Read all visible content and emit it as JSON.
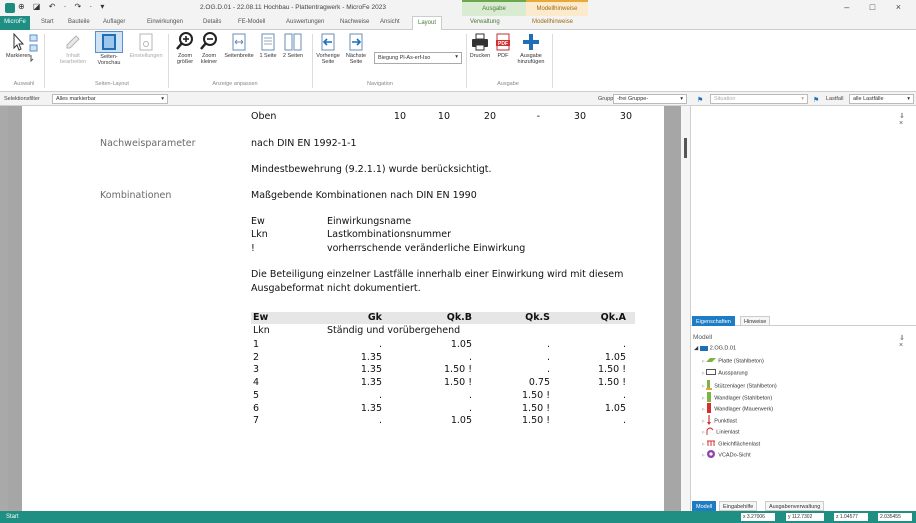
{
  "titlebar": {
    "quick_access": "⊕ ◪ ↶ · ↷ · ▾",
    "title": "2.OG.D.01 - 22.08.11 Hochbau - Plattentragwerk - MicroFe 2023",
    "context_tab_ausgabe": "Ausgabe",
    "context_tab_modellhinweise": "Modellhinweise",
    "window_buttons": "–  □  ×"
  },
  "tabs": {
    "file": "MicroFe",
    "items": [
      "Start",
      "Bauteile",
      "Auflager",
      "Einwirkungen",
      "Details",
      "FE-Modell",
      "Auswertungen",
      "Nachweise",
      "Ansicht",
      "Layout",
      "Verwaltung",
      "Modellhinweise"
    ],
    "collapse": "^ ?"
  },
  "ribbon": {
    "markieren": "Markieren",
    "auswahl_group": "Auswahl",
    "inhalt_bearbeiten": [
      "Inhalt",
      "bearbeiten"
    ],
    "seiten_vorschau": [
      "Seiten-",
      "Vorschau"
    ],
    "einstellungen": "Einstellungen",
    "seiten_layout_group": "Seiten-Layout",
    "zoom_groesser": [
      "Zoom",
      "größer"
    ],
    "zoom_kleiner": [
      "Zoom",
      "kleiner"
    ],
    "seitenbreite": "Seitenbreite",
    "eine_seite": "1 Seite",
    "zwei_seiten": "2 Seiten",
    "anzeige_group": "Anzeige anpassen",
    "vorherige_seite": [
      "Vorherige",
      "Seite"
    ],
    "naechste_seite": [
      "Nächste",
      "Seite"
    ],
    "combo_value": "Biegung Pl-As-erf-Iso",
    "navigation_group": "Navigation",
    "drucken": "Drucken",
    "pdf": "PDF",
    "ausgabe_hinzufuegen": [
      "Ausgabe",
      "hinzufügen"
    ],
    "ausgabe_group": "Ausgabe"
  },
  "filterbar": {
    "selektionsfilter_label": "Selektionsfilter",
    "selektionsfilter_value": "Alles markierbar",
    "gruppe_label": "Gruppe",
    "gruppe_value": "-frei Gruppe-",
    "situation_placeholder": "Situation",
    "lastfall_label": "Lastfall",
    "lastfall_value": "alle Lastfälle"
  },
  "document": {
    "top_row": {
      "label": "Oben",
      "v1": "10",
      "v2": "10",
      "v3": "20",
      "v4": "-",
      "v5": "30",
      "v6": "30"
    },
    "nachweis_heading": "Nachweisparameter",
    "nachweis_norm": "nach DIN EN 1992-1-1",
    "mindestbewehrung": "Mindestbewehrung (9.2.1.1) wurde berücksichtigt.",
    "kombinationen_heading": "Kombinationen",
    "kombinationen_text": "Maßgebende Kombinationen nach DIN EN 1990",
    "legend": [
      {
        "key": "Ew",
        "desc": "Einwirkungsname"
      },
      {
        "key": "Lkn",
        "desc": "Lastkombinationsnummer"
      },
      {
        "key": "!",
        "desc": "vorherrschende veränderliche Einwirkung"
      }
    ],
    "note_line1": "Die Beteiligung einzelner Lastfälle innerhalb einer Einwirkung wird mit diesem",
    "note_line2": "Ausgabeformat nicht dokumentiert.",
    "table": {
      "headers": [
        "Ew",
        "Gk",
        "Qk.B",
        "Qk.S",
        "Qk.A"
      ],
      "sub_lkn": "Lkn",
      "sub_desc": "Ständig und vorübergehend",
      "rows": [
        [
          "1",
          ".",
          "1.05",
          ".",
          "."
        ],
        [
          "2",
          "1.35",
          ".",
          ".",
          "1.05"
        ],
        [
          "3",
          "1.35",
          "1.50 !",
          ".",
          "1.50 !"
        ],
        [
          "4",
          "1.35",
          "1.50 !",
          "0.75",
          "1.50 !"
        ],
        [
          "5",
          ".",
          ".",
          "1.50 !",
          "."
        ],
        [
          "6",
          "1.35",
          ".",
          "1.50 !",
          "1.05"
        ],
        [
          "7",
          ".",
          "1.05",
          "1.50 !",
          "."
        ]
      ]
    }
  },
  "right_panel": {
    "pin_close": "⇓ ×",
    "tab_eigenschaften": "Eigenschaften",
    "tab_hinweise": "Hinweise",
    "modell_heading": "Modell",
    "tree_root": "2.OG.D.01",
    "tree_items": [
      "Platte (Stahlbeton)",
      "Aussparung",
      "Stützenlager (Stahlbeton)",
      "Wandlager (Stahlbeton)",
      "Wandlager (Mauerwerk)",
      "Punktlast",
      "Linienlast",
      "Gleichflächenlast",
      "VCADo-Sicht"
    ],
    "bottom_tabs": [
      "Modell",
      "Eingabehilfe",
      "Ausgabenverwaltung"
    ]
  },
  "statusbar": {
    "left": "Start",
    "coords": [
      "x 3.27006",
      "y 112.7302",
      "z 1.04577",
      "2.035455"
    ]
  },
  "colors": {
    "accent": "#1e8f82",
    "selection": "#1e7cc4",
    "context_ausgabe": "#d9ecd2",
    "context_modell": "#fbeacc"
  }
}
